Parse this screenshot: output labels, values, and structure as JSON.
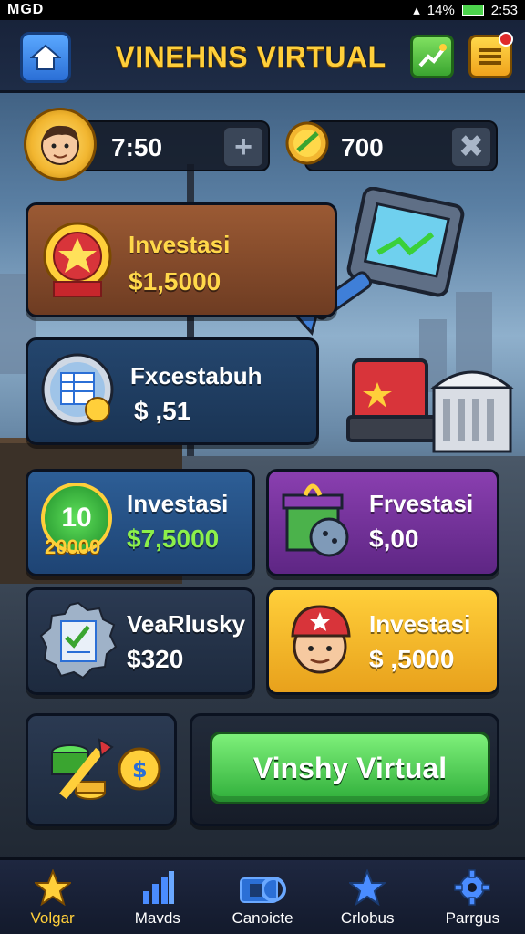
{
  "status_bar": {
    "carrier": "MGD",
    "signal": "14%",
    "time": "2:53"
  },
  "header": {
    "title": "VINEHNS VIRTUAL"
  },
  "stats": {
    "timer_value": "7:50",
    "coins_value": "700"
  },
  "cards": [
    {
      "label": "Investasi",
      "amount": "$1,5000",
      "amount_color": "#ffd84a"
    },
    {
      "label": "Fxcestabuh",
      "amount": "$ ,51",
      "amount_color": "#ffffff"
    },
    {
      "label": "Investasi",
      "amount": "$7,5000",
      "amount_color": "#8cf04a",
      "badge_top": "10",
      "badge_bottom": "20000"
    },
    {
      "label": "Frvestasi",
      "amount": "$,00",
      "amount_color": "#ffffff"
    },
    {
      "label": "VeaRlusky",
      "amount": "$320",
      "amount_color": "#ffffff"
    },
    {
      "label": "Investasi",
      "amount": "$ ,5000",
      "amount_color": "#ffffff"
    }
  ],
  "cta": {
    "label": "Vinshy Virtual"
  },
  "bottom_nav": [
    {
      "label": "Volgar",
      "icon": "star-icon",
      "active": true
    },
    {
      "label": "Mavds",
      "icon": "bars-icon",
      "active": false
    },
    {
      "label": "Canoicte",
      "icon": "camera-icon",
      "active": false
    },
    {
      "label": "Crlobus",
      "icon": "star-blue-icon",
      "active": false
    },
    {
      "label": "Parrgus",
      "icon": "gear-icon",
      "active": false
    }
  ],
  "colors": {
    "accent_gold": "#ffcf3a",
    "cta_green": "#2fae3a",
    "header_bg": "#18233a"
  }
}
